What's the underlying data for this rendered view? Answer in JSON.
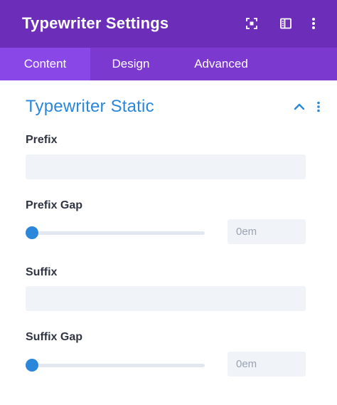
{
  "header": {
    "title": "Typewriter Settings",
    "icons": [
      "focus-icon",
      "sidebar-toggle-icon",
      "more-vertical-icon"
    ],
    "bg_color": "#6c2eb9"
  },
  "tabs": [
    {
      "label": "Content",
      "active": true
    },
    {
      "label": "Design",
      "active": false
    },
    {
      "label": "Advanced",
      "active": false
    }
  ],
  "section": {
    "title": "Typewriter Static",
    "accent_color": "#2b87da",
    "icons": [
      "chevron-up-icon",
      "more-vertical-icon"
    ]
  },
  "fields": {
    "prefix": {
      "label": "Prefix",
      "value": ""
    },
    "prefix_gap": {
      "label": "Prefix Gap",
      "value": "0em",
      "slider_fraction": 0
    },
    "suffix": {
      "label": "Suffix",
      "value": ""
    },
    "suffix_gap": {
      "label": "Suffix Gap",
      "value": "0em",
      "slider_fraction": 0
    }
  }
}
